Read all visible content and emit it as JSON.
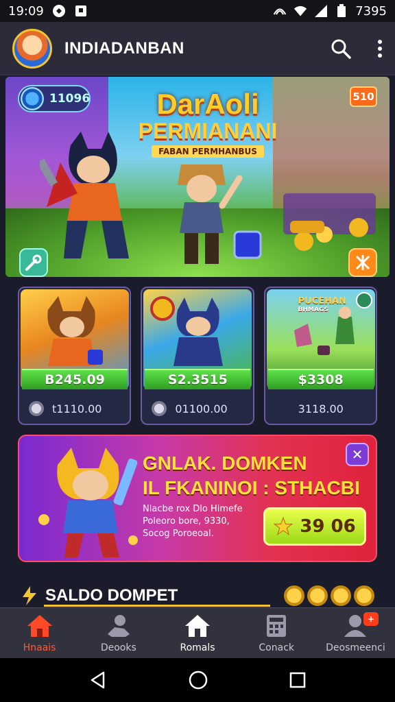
{
  "status_bar": {
    "time": "19:09",
    "battery_text": "7395"
  },
  "app_bar": {
    "title": "INDIADANBAN"
  },
  "hero": {
    "coin_value": "11096",
    "title_line1": "DarAoli",
    "title_line2": "PERMIANANI",
    "ribbon": "FABAN PERMHANBUS",
    "badge": "510"
  },
  "cards": [
    {
      "price": "B245.09",
      "footer": "t1110.00"
    },
    {
      "price": "S2.3515",
      "footer": "01100.00"
    },
    {
      "price": "$3308",
      "footer": "3118.00",
      "art_label": "PUCEHAN",
      "art_sub": "BHMAGS"
    }
  ],
  "promo": {
    "heading_line1": "GNLAK. DOMKEN",
    "heading_line2": "IL FKANINOI : STHACBI",
    "description": "Nlacbe rox Dlo Himefe Poleoro bore, 9330, Socog Poroeoal.",
    "cta_value": "39 06",
    "close": "✕"
  },
  "saldo": {
    "label": "SALDO DOMPET"
  },
  "bottom_nav": [
    {
      "label": "Hnaais"
    },
    {
      "label": "Deooks"
    },
    {
      "label": "Romals"
    },
    {
      "label": "Conack"
    },
    {
      "label": "Deosmeenci",
      "badge": "+"
    }
  ],
  "colors": {
    "accent_gold": "#f4c531",
    "nav_active": "#ff5a3a",
    "price_green": "#3fbf2c",
    "promo_red": "#e0223b"
  }
}
